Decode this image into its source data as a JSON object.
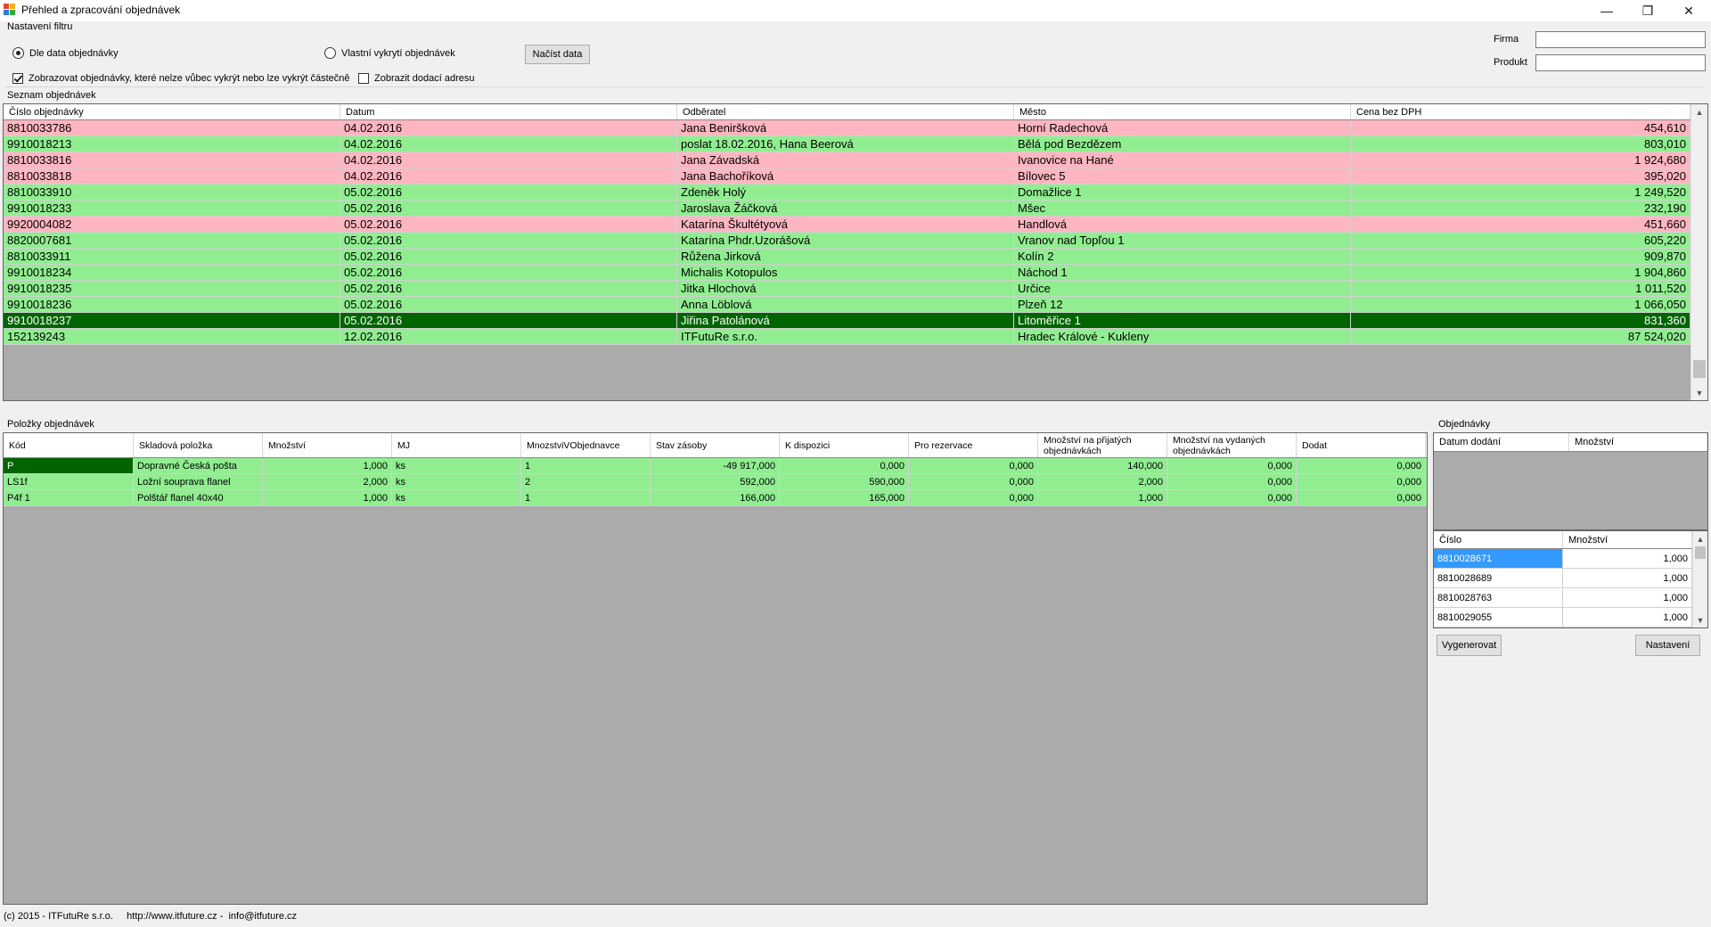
{
  "window": {
    "title": "Přehled a zpracování objednávek"
  },
  "filter": {
    "group_label": "Nastavení filtru",
    "radio_order_date": "Dle data objednávky",
    "radio_custom": "Vlastní vykrytí objednávek",
    "load_button": "Načíst data",
    "check_unfulfillable": "Zobrazovat objednávky, které nelze vůbec vykrýt nebo lze vykrýt částečně",
    "check_delivery_address": "Zobrazit dodací adresu",
    "firma_label": "Firma",
    "firma_value": "",
    "produkt_label": "Produkt",
    "produkt_value": ""
  },
  "orders": {
    "group_label": "Seznam objednávek",
    "columns": [
      "Číslo objednávky",
      "Datum",
      "Odběratel",
      "Město",
      "Cena bez DPH"
    ],
    "rows": [
      {
        "cells": [
          "8810033786",
          "04.02.2016",
          "Jana Beniršková",
          "Horní Radechová",
          "454,610"
        ],
        "status": "pink"
      },
      {
        "cells": [
          "9910018213",
          "04.02.2016",
          "poslat 18.02.2016, Hana Beerová",
          "Bělá pod Bezdězem",
          "803,010"
        ],
        "status": "green"
      },
      {
        "cells": [
          "8810033816",
          "04.02.2016",
          "Jana Závadská",
          "Ivanovice na Hané",
          "1 924,680"
        ],
        "status": "pink"
      },
      {
        "cells": [
          "8810033818",
          "04.02.2016",
          "Jana Bachoříková",
          "Bílovec 5",
          "395,020"
        ],
        "status": "pink"
      },
      {
        "cells": [
          "8810033910",
          "05.02.2016",
          "Zdeněk Holý",
          "Domažlice 1",
          "1 249,520"
        ],
        "status": "green"
      },
      {
        "cells": [
          "9910018233",
          "05.02.2016",
          "Jaroslava Žáčková",
          "Mšec",
          "232,190"
        ],
        "status": "green"
      },
      {
        "cells": [
          "9920004082",
          "05.02.2016",
          "Katarína Škultétyová",
          "Handlová",
          "451,660"
        ],
        "status": "pink"
      },
      {
        "cells": [
          "8820007681",
          "05.02.2016",
          "Katarína Phdr.Uzorášová",
          "Vranov nad Topľou 1",
          "605,220"
        ],
        "status": "green"
      },
      {
        "cells": [
          "8810033911",
          "05.02.2016",
          "Růžena Jirková",
          "Kolín 2",
          "909,870"
        ],
        "status": "green"
      },
      {
        "cells": [
          "9910018234",
          "05.02.2016",
          "Michalis Kotopulos",
          "Náchod 1",
          "1 904,860"
        ],
        "status": "green"
      },
      {
        "cells": [
          "9910018235",
          "05.02.2016",
          "Jitka Hlochová",
          "Určice",
          "1 011,520"
        ],
        "status": "green"
      },
      {
        "cells": [
          "9910018236",
          "05.02.2016",
          "Anna Löblová",
          "Plzeň 12",
          "1 066,050"
        ],
        "status": "green"
      },
      {
        "cells": [
          "9910018237",
          "05.02.2016",
          "Jiřina Patolánová",
          "Litoměřice 1",
          "831,360"
        ],
        "status": "dark"
      },
      {
        "cells": [
          "152139243",
          "12.02.2016",
          "ITFutuRe s.r.o.",
          "Hradec Králové - Kukleny",
          "87 524,020"
        ],
        "status": "green"
      }
    ]
  },
  "items": {
    "group_label": "Položky objednávek",
    "columns": [
      "Kód",
      "Skladová položka",
      "Množství",
      "MJ",
      "MnozstviVObjednavce",
      "Stav zásoby",
      "K dispozici",
      "Pro rezervace",
      "Množství na přijatých objednávkách",
      "Množství na vydaných objednávkách",
      "Dodat"
    ],
    "rows": [
      [
        "P",
        "Dopravné Česká pošta",
        "1,000",
        "ks",
        "1",
        "-49 917,000",
        "0,000",
        "0,000",
        "140,000",
        "0,000",
        "0,000"
      ],
      [
        "LS1f",
        "Ložní souprava flanel",
        "2,000",
        "ks",
        "2",
        "592,000",
        "590,000",
        "0,000",
        "2,000",
        "0,000",
        "0,000"
      ],
      [
        "P4f 1",
        "Polštář flanel 40x40",
        "1,000",
        "ks",
        "1",
        "166,000",
        "165,000",
        "0,000",
        "1,000",
        "0,000",
        "0,000"
      ]
    ]
  },
  "side": {
    "group_label": "Objednávky",
    "delivery_columns": [
      "Datum dodání",
      "Množství"
    ],
    "number_columns": [
      "Číslo",
      "Množství"
    ],
    "number_rows": [
      [
        "8810028671",
        "1,000"
      ],
      [
        "8810028689",
        "1,000"
      ],
      [
        "8810028763",
        "1,000"
      ],
      [
        "8810029055",
        "1,000"
      ]
    ],
    "generate_button": "Vygenerovat",
    "settings_button": "Nastavení"
  },
  "footer": {
    "text": "(c) 2015 - ITFutuRe s.r.o.     http://www.itfuture.cz -  info@itfuture.cz"
  }
}
